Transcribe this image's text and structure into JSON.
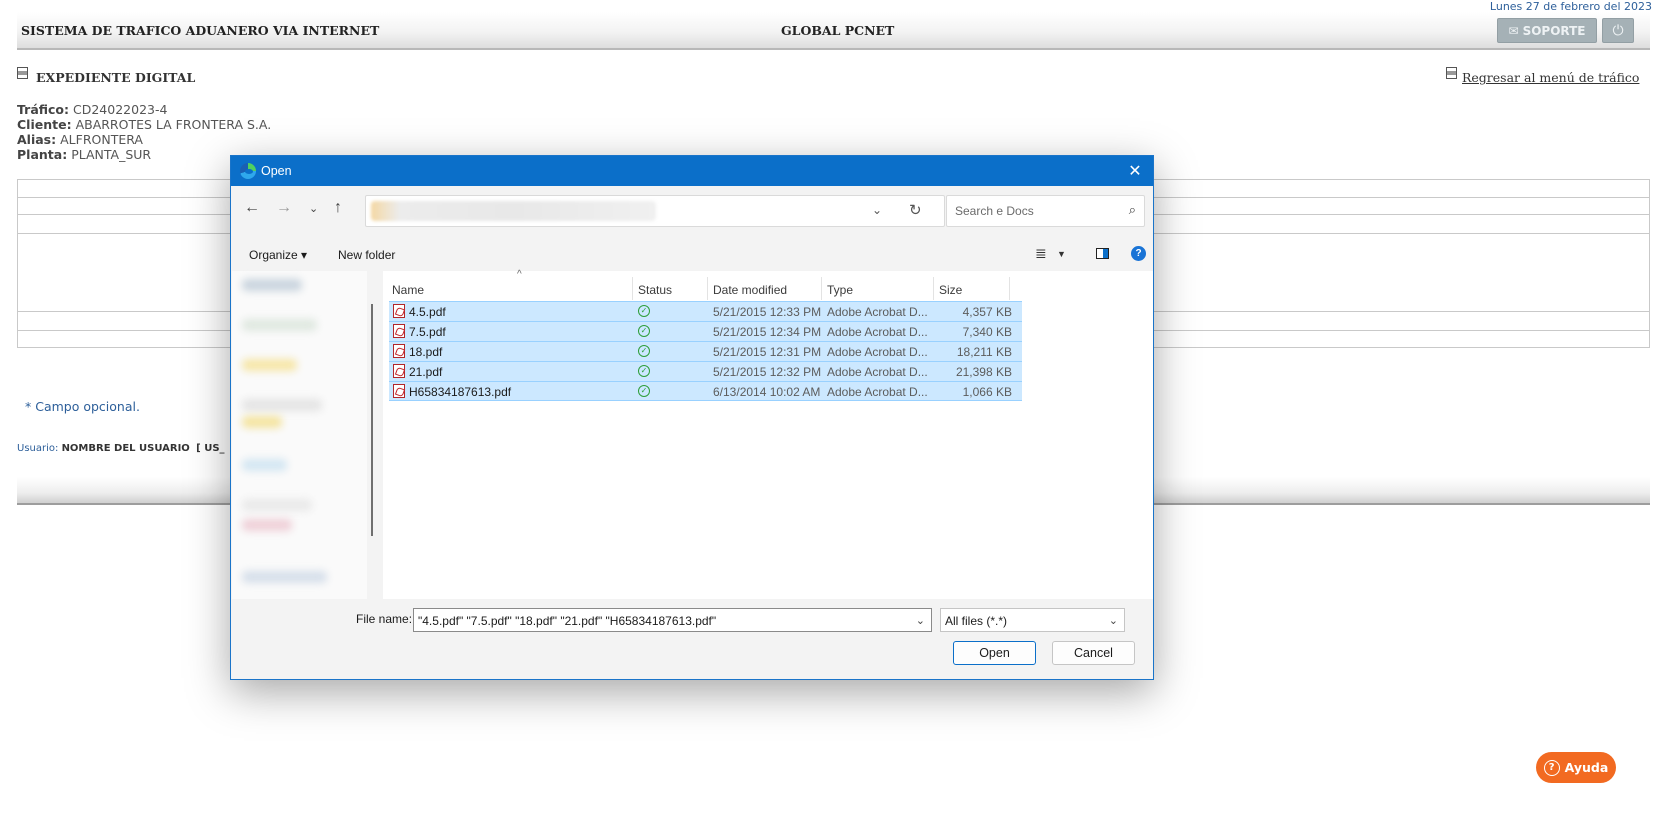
{
  "header": {
    "date": "Lunes 27 de febrero del 2023",
    "system_title": "SISTEMA DE TRAFICO ADUANERO VIA INTERNET",
    "center_title": "GLOBAL PCNET",
    "soporte_label": "SOPORTE",
    "power_icon": "⏻"
  },
  "page": {
    "section_title": "EXPEDIENTE DIGITAL",
    "return_link": "Regresar al menú de tráfico",
    "info": [
      {
        "label": "Tráfico:",
        "value": "CD24022023-4"
      },
      {
        "label": "Cliente:",
        "value": "ABARROTES LA FRONTERA S.A."
      },
      {
        "label": "Alias:",
        "value": "ALFRONTERA"
      },
      {
        "label": "Planta:",
        "value": "PLANTA_SUR"
      }
    ],
    "optional_note": "* Campo opcional.",
    "usuario_label": "Usuario:",
    "usuario_name": "NOMBRE DEL USUARIO",
    "usuario_code": "[ US_",
    "ayuda_label": "Ayuda"
  },
  "dialog": {
    "title": "Open",
    "search_placeholder": "Search e Docs",
    "organize_label": "Organize ▾",
    "new_folder_label": "New folder",
    "columns": {
      "name": "Name",
      "status": "Status",
      "date": "Date modified",
      "type": "Type",
      "size": "Size"
    },
    "files": [
      {
        "name": "4.5.pdf",
        "date": "5/21/2015 12:33 PM",
        "type": "Adobe Acrobat D...",
        "size": "4,357 KB"
      },
      {
        "name": "7.5.pdf",
        "date": "5/21/2015 12:34 PM",
        "type": "Adobe Acrobat D...",
        "size": "7,340 KB"
      },
      {
        "name": "18.pdf",
        "date": "5/21/2015 12:31 PM",
        "type": "Adobe Acrobat D...",
        "size": "18,211 KB"
      },
      {
        "name": "21.pdf",
        "date": "5/21/2015 12:32 PM",
        "type": "Adobe Acrobat D...",
        "size": "21,398 KB"
      },
      {
        "name": "H65834187613.pdf",
        "date": "6/13/2014 10:02 AM",
        "type": "Adobe Acrobat D...",
        "size": "1,066 KB"
      }
    ],
    "file_name_label": "File name:",
    "file_name_value": "\"4.5.pdf\" \"7.5.pdf\" \"18.pdf\" \"21.pdf\" \"H65834187613.pdf\"",
    "file_type_value": "All files (*.*)",
    "open_button": "Open",
    "cancel_button": "Cancel"
  }
}
